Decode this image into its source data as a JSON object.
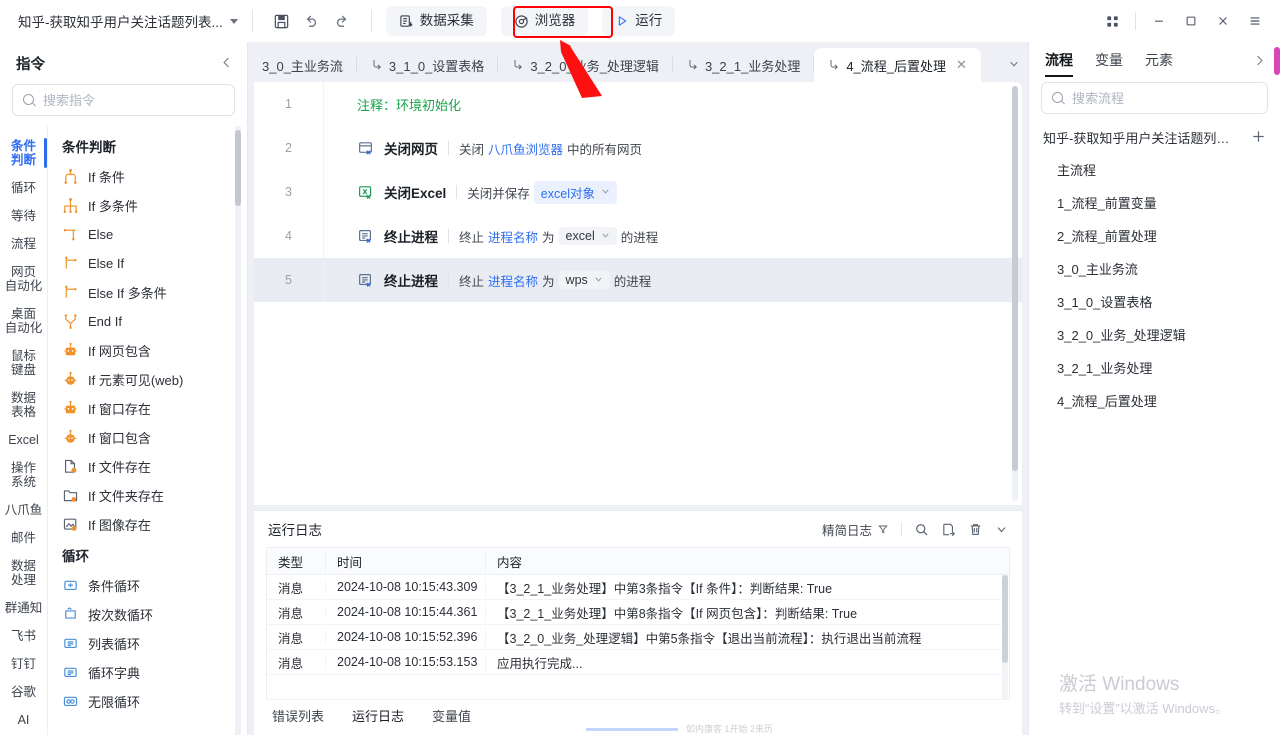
{
  "topbar": {
    "doc_title": "知乎-获取知乎用户关注话题列表...",
    "save_icon": "save-icon",
    "undo_icon": "undo-icon",
    "redo_icon": "redo-icon",
    "collect_label": "数据采集",
    "browser_label": "浏览器",
    "run_label": "运行",
    "grid_icon": "grid-apps-icon",
    "minimize": "−",
    "maximize": "□",
    "close": "✕",
    "highlight_color": "#ff0000"
  },
  "left_panel": {
    "title": "指令",
    "collapse_icon": "chevron-left-icon",
    "search_placeholder": "搜索指令",
    "search_value": "",
    "categories": [
      {
        "label": "条件\n判断",
        "active": true
      },
      {
        "label": "循环",
        "active": false
      },
      {
        "label": "等待",
        "active": false
      },
      {
        "label": "流程",
        "active": false
      },
      {
        "label": "网页\n自动化",
        "active": false
      },
      {
        "label": "桌面\n自动化",
        "active": false
      },
      {
        "label": "鼠标\n键盘",
        "active": false
      },
      {
        "label": "数据\n表格",
        "active": false
      },
      {
        "label": "Excel",
        "active": false
      },
      {
        "label": "操作\n系统",
        "active": false
      },
      {
        "label": "八爪鱼",
        "active": false
      },
      {
        "label": "邮件",
        "active": false
      },
      {
        "label": "数据\n处理",
        "active": false
      },
      {
        "label": "群通知",
        "active": false
      },
      {
        "label": "飞书",
        "active": false
      },
      {
        "label": "钉钉",
        "active": false
      },
      {
        "label": "谷歌",
        "active": false
      },
      {
        "label": "AI",
        "active": false
      }
    ],
    "groups": [
      {
        "title": "条件判断",
        "items": [
          {
            "label": "If 条件",
            "icon": "branch-if-icon"
          },
          {
            "label": "If 多条件",
            "icon": "branch-multi-if-icon"
          },
          {
            "label": "Else",
            "icon": "branch-else-icon"
          },
          {
            "label": "Else If",
            "icon": "branch-elseif-icon"
          },
          {
            "label": "Else If 多条件",
            "icon": "branch-elseif-multi-icon"
          },
          {
            "label": "End If",
            "icon": "branch-endif-icon"
          },
          {
            "label": "If 网页包含",
            "icon": "web-contains-icon"
          },
          {
            "label": "If 元素可见(web)",
            "icon": "element-visible-icon"
          },
          {
            "label": "If 窗口存在",
            "icon": "window-exists-icon"
          },
          {
            "label": "If 窗口包含",
            "icon": "window-contains-icon"
          },
          {
            "label": "If 文件存在",
            "icon": "file-exists-icon"
          },
          {
            "label": "If 文件夹存在",
            "icon": "folder-exists-icon"
          },
          {
            "label": "If 图像存在",
            "icon": "image-exists-icon"
          }
        ]
      },
      {
        "title": "循环",
        "items": [
          {
            "label": "条件循环",
            "icon": "loop-condition-icon"
          },
          {
            "label": "按次数循环",
            "icon": "loop-count-icon"
          },
          {
            "label": "列表循环",
            "icon": "loop-list-icon"
          },
          {
            "label": "循环字典",
            "icon": "loop-dict-icon"
          },
          {
            "label": "无限循环",
            "icon": "loop-infinite-icon"
          }
        ]
      }
    ]
  },
  "tabs": [
    {
      "label": "3_0_主业务流",
      "active": false,
      "has_icon": false
    },
    {
      "label": "3_1_0_设置表格",
      "active": false,
      "has_icon": true
    },
    {
      "label": "3_2_0_业务_处理逻辑",
      "active": false,
      "has_icon": true
    },
    {
      "label": "3_2_1_业务处理",
      "active": false,
      "has_icon": true
    },
    {
      "label": "4_流程_后置处理",
      "active": true,
      "has_icon": true
    }
  ],
  "tab_more_icon": "chevron-down-icon",
  "editor": {
    "steps": [
      {
        "num": "1",
        "kind": "comment",
        "comment": "注释：环境初始化",
        "selected": false
      },
      {
        "num": "2",
        "kind": "command",
        "icon": "close-webpage-icon",
        "name": "关闭网页",
        "desc_parts": [
          {
            "text": "关闭",
            "style": "plain"
          },
          {
            "text": "八爪鱼浏览器",
            "style": "link"
          },
          {
            "text": "中的所有网页",
            "style": "plain"
          }
        ],
        "selected": false
      },
      {
        "num": "3",
        "kind": "command",
        "icon": "close-excel-icon",
        "name": "关闭Excel",
        "desc_parts": [
          {
            "text": "关闭并保存",
            "style": "plain"
          },
          {
            "text": "excel对象",
            "style": "chip"
          }
        ],
        "selected": false
      },
      {
        "num": "4",
        "kind": "command",
        "icon": "kill-process-icon",
        "name": "终止进程",
        "desc_parts": [
          {
            "text": "终止",
            "style": "plain"
          },
          {
            "text": "进程名称",
            "style": "link"
          },
          {
            "text": "为",
            "style": "plain"
          },
          {
            "text": "excel",
            "style": "chip-plain"
          },
          {
            "text": "的进程",
            "style": "plain"
          }
        ],
        "selected": false
      },
      {
        "num": "5",
        "kind": "command",
        "icon": "kill-process-icon",
        "name": "终止进程",
        "desc_parts": [
          {
            "text": "终止",
            "style": "plain"
          },
          {
            "text": "进程名称",
            "style": "link"
          },
          {
            "text": "为",
            "style": "plain"
          },
          {
            "text": "wps",
            "style": "chip-plain"
          },
          {
            "text": "的进程",
            "style": "plain"
          }
        ],
        "selected": true
      }
    ]
  },
  "log_panel": {
    "title": "运行日志",
    "filter_label": "精简日志",
    "filter_icon": "filter-icon",
    "search_icon": "search-icon",
    "export_icon": "export-log-icon",
    "delete_icon": "trash-icon",
    "more_icon": "chevron-down-icon",
    "columns": [
      "类型",
      "时间",
      "内容"
    ],
    "rows": [
      {
        "type": "消息",
        "time": "2024-10-08 10:15:43.309",
        "content": "【3_2_1_业务处理】中第3条指令【If 条件】：判断结果: True"
      },
      {
        "type": "消息",
        "time": "2024-10-08 10:15:44.361",
        "content": "【3_2_1_业务处理】中第8条指令【If 网页包含】：判断结果: True"
      },
      {
        "type": "消息",
        "time": "2024-10-08 10:15:52.396",
        "content": "【3_2_0_业务_处理逻辑】中第5条指令【退出当前流程】：执行退出当前流程"
      },
      {
        "type": "消息",
        "time": "2024-10-08 10:15:53.153",
        "content": "应用执行完成..."
      }
    ],
    "bottom_tabs": [
      {
        "label": "错误列表",
        "active": false
      },
      {
        "label": "运行日志",
        "active": true
      },
      {
        "label": "变量值",
        "active": false
      }
    ]
  },
  "right_panel": {
    "tabs": [
      {
        "label": "流程",
        "active": true
      },
      {
        "label": "变量",
        "active": false
      },
      {
        "label": "元素",
        "active": false
      }
    ],
    "expand_icon": "chevron-right-icon",
    "search_placeholder": "搜索流程",
    "search_value": "",
    "project_name": "知乎-获取知乎用户关注话题列表-...",
    "add_icon": "plus-icon",
    "flows": [
      {
        "label": "主流程"
      },
      {
        "label": "1_流程_前置变量"
      },
      {
        "label": "2_流程_前置处理"
      },
      {
        "label": "3_0_主业务流"
      },
      {
        "label": "3_1_0_设置表格"
      },
      {
        "label": "3_2_0_业务_处理逻辑"
      },
      {
        "label": "3_2_1_业务处理"
      },
      {
        "label": "4_流程_后置处理"
      }
    ],
    "watermark_line1": "激活 Windows",
    "watermark_line2": "转到“设置”以激活 Windows。"
  }
}
